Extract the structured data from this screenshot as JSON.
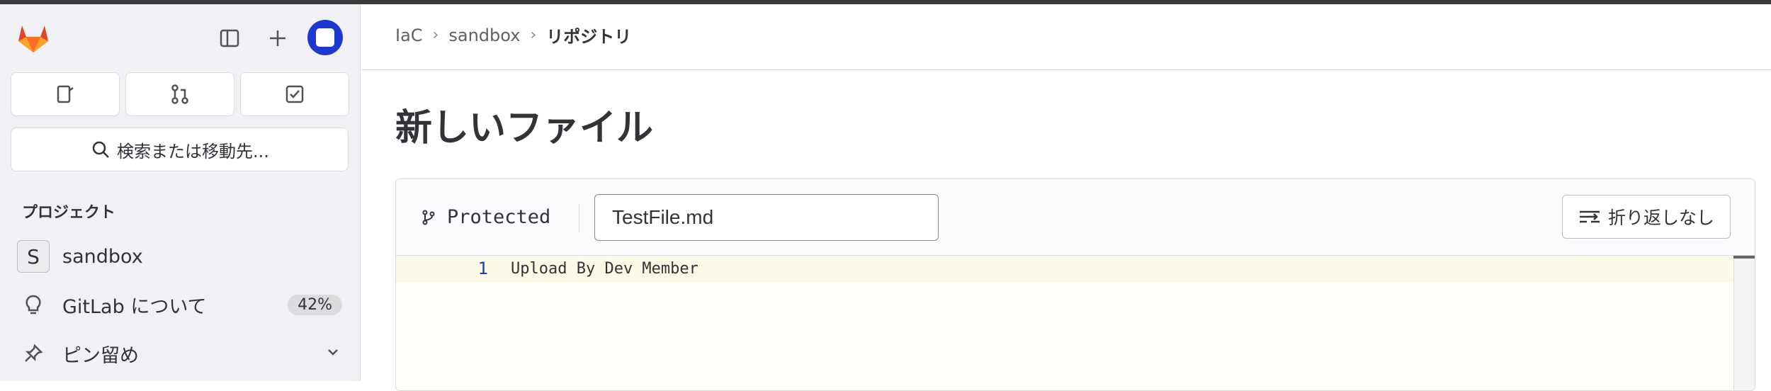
{
  "sidebar": {
    "search_label": "検索または移動先...",
    "section_title": "プロジェクト",
    "project": {
      "initial": "S",
      "name": "sandbox"
    },
    "items": [
      {
        "label": "GitLab について",
        "badge": "42%"
      },
      {
        "label": "ピン留め"
      }
    ]
  },
  "breadcrumb": {
    "items": [
      "IaC",
      "sandbox"
    ],
    "current": "リポジトリ"
  },
  "page": {
    "title": "新しいファイル"
  },
  "editor": {
    "branch": "Protected",
    "filename": "TestFile.md",
    "wrap_label": "折り返しなし",
    "lines": [
      {
        "number": "1",
        "text": "Upload By Dev Member"
      }
    ]
  },
  "colors": {
    "accent": "#1f37d1",
    "logo": "#e24329"
  }
}
